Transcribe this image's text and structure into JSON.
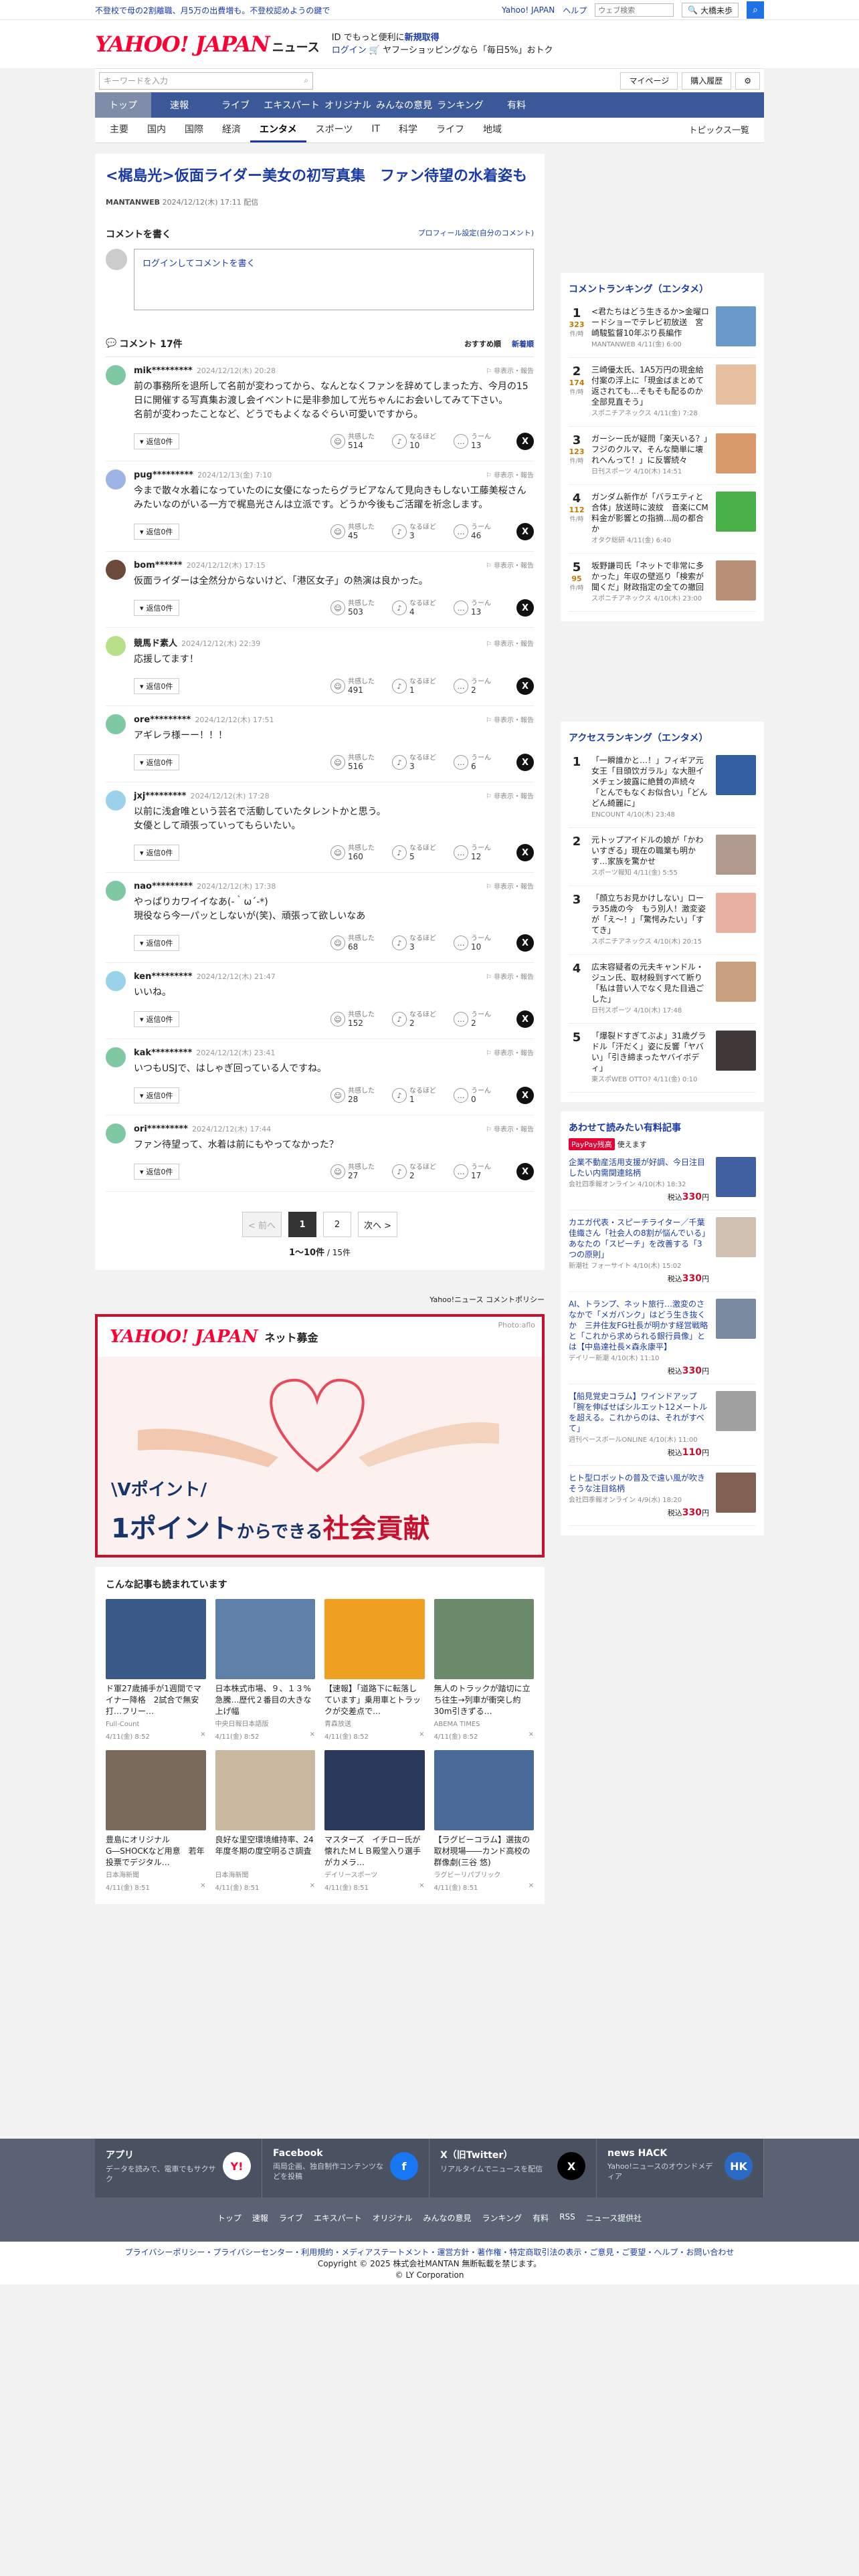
{
  "promo": {
    "text": "不登校で母の2割離職、月5万の出費増も。不登校認めようの鍵で",
    "links": [
      "Yahoo! JAPAN",
      "ヘルプ"
    ],
    "search_placeholder": "ウェブ検索",
    "bigsearch": "大橋未歩"
  },
  "header": {
    "logo": "YAHOO! JAPAN",
    "service": "ニュース",
    "msg1": "ID でもっと便利に",
    "msg1_link": "新規取得",
    "login": "ログイン",
    "msg2": "ヤフーショッピングなら「毎日5%」おトク"
  },
  "bar": {
    "search_placeholder": "キーワードを入力",
    "mypage": "マイページ",
    "purchase": "購入履歴"
  },
  "gnav": [
    "トップ",
    "速報",
    "ライブ",
    "エキスパート",
    "オリジナル",
    "みんなの意見",
    "ランキング",
    "有料"
  ],
  "cnav": [
    "主要",
    "国内",
    "国際",
    "経済",
    "エンタメ",
    "スポーツ",
    "IT",
    "科学",
    "ライフ",
    "地域"
  ],
  "cnav_right": "トピックス一覧",
  "article": {
    "title": "<梶島光>仮面ライダー美女の初写真集　ファン待望の水着姿も",
    "source": "MANTANWEB",
    "date": "2024/12/12(木) 17:11 配信"
  },
  "comment_write": {
    "label": "コメントを書く",
    "profile_link": "プロフィール設定(自分のコメント)",
    "login": "ログイン",
    "placeholder": "してコメントを書く"
  },
  "list": {
    "count": "コメント 17件",
    "sort_recommend": "おすすめ順",
    "sort_new": "新着順",
    "report": "非表示・報告",
    "reply": "返信0件",
    "rx": [
      "共感した",
      "なるほど",
      "うーん"
    ]
  },
  "comments": [
    {
      "user": "mik*********",
      "date": "2024/12/12(木) 20:28",
      "text": "前の事務所を退所して名前が変わってから、なんとなくファンを辞めてしまった方、今月の15日に開催する写真集お渡し会イベントに是非参加して光ちゃんにお会いしてみて下さい。\n名前が変わったことなど、どうでもよくなるぐらい可愛いですから。",
      "e": "514",
      "n": "10",
      "u": "13",
      "c": "#7ec8a3"
    },
    {
      "user": "pug*********",
      "date": "2024/12/13(金) 7:10",
      "text": "今まで散々水着になっていたのに女優になったらグラビアなんて見向きもしない工藤美桜さんみたいなのがいる一方で梶島光さんは立派です。どうか今後もご活躍を祈念します。",
      "e": "45",
      "n": "3",
      "u": "46",
      "c": "#9eb3e6"
    },
    {
      "user": "bom******",
      "date": "2024/12/12(木) 17:15",
      "text": "仮面ライダーは全然分からないけど、「港区女子」の熱演は良かった。",
      "e": "503",
      "n": "4",
      "u": "13",
      "c": "#6b4a3a"
    },
    {
      "user": "競馬ド素人",
      "date": "2024/12/12(木) 22:39",
      "text": "応援してます！",
      "e": "491",
      "n": "1",
      "u": "2",
      "c": "#b8e08a"
    },
    {
      "user": "ore*********",
      "date": "2024/12/12(木) 17:51",
      "text": "アギレラ様ーー！！！",
      "e": "516",
      "n": "3",
      "u": "6",
      "c": "#7ec8a3"
    },
    {
      "user": "jxj*********",
      "date": "2024/12/12(木) 17:28",
      "text": "以前に浅倉唯という芸名で活動していたタレントかと思う。\n女優として頑張っていってもらいたい。",
      "e": "160",
      "n": "5",
      "u": "12",
      "c": "#9ad2ec"
    },
    {
      "user": "nao*********",
      "date": "2024/12/12(木) 17:38",
      "text": "やっぱりカワイイなあ(-｀ω´-*)\n現役なら今一パッとしないが(笑)、頑張って欲しいなあ",
      "e": "68",
      "n": "3",
      "u": "10",
      "c": "#7ec8a3"
    },
    {
      "user": "ken*********",
      "date": "2024/12/12(木) 21:47",
      "text": "いいね。",
      "e": "152",
      "n": "2",
      "u": "2",
      "c": "#9ad2ec"
    },
    {
      "user": "kak*********",
      "date": "2024/12/12(木) 23:41",
      "text": "いつもUSJで、はしゃぎ回っている人ですね。",
      "e": "28",
      "n": "1",
      "u": "0",
      "c": "#7ec8a3"
    },
    {
      "user": "ori*********",
      "date": "2024/12/12(木) 17:44",
      "text": "ファン待望って、水着は前にもやってなかった？",
      "e": "27",
      "n": "2",
      "u": "17",
      "c": "#7ec8a3"
    }
  ],
  "pager": {
    "prev": "< 前へ",
    "next": "次へ >",
    "pages": [
      "1",
      "2"
    ],
    "count": "1〜10件",
    "total": "/ 15件"
  },
  "policy_link": "Yahoo!ニュース コメントポリシー",
  "ad": {
    "logo": "YAHOO! JAPAN",
    "name": "ネット募金",
    "credit": "Photo:aflo",
    "line1": "\\Vポイント/",
    "line2a": "1ポイント",
    "line2b": "からできる",
    "line2c": "社会貢献"
  },
  "recommended": {
    "heading": "こんな記事も読まれています",
    "items": [
      {
        "t": "ド軍27歳捕手が1週間でマイナー降格　2試合で無安打…フリー…",
        "s": "Full-Count",
        "d": "4/11(金) 8:52",
        "c": "#3a5a8a"
      },
      {
        "t": "日本株式市場、９、１３%急騰…歴代２番目の大きな上げ幅",
        "s": "中央日報日本語版",
        "d": "4/11(金) 8:52",
        "c": "#5d7fa8"
      },
      {
        "t": "【速報】「道路下に転落しています」乗用車とトラックが交差点で…",
        "s": "青森放送",
        "d": "4/11(金) 8:52",
        "c": "#f0a020"
      },
      {
        "t": "無人のトラックが踏切に立ち往生→列車が衝突し約30m引きずる…",
        "s": "ABEMA TIMES",
        "d": "4/11(金) 8:52",
        "c": "#6a8a6a"
      },
      {
        "t": "豊島にオリジナルG―SHOCKなど用意　若年投票でデジタル…",
        "s": "日本海新聞",
        "d": "4/11(金) 8:51",
        "c": "#7a6a5a"
      },
      {
        "t": "良好な里空環境維持率、24年度冬期の度空明るさ調査",
        "s": "日本海新聞",
        "d": "4/11(金) 8:51",
        "c": "#c8b8a0"
      },
      {
        "t": "マスターズ　イチロー氏が懐れたＭＬＢ殿堂入り選手がカメラ…",
        "s": "デイリースポーツ",
        "d": "4/11(金) 8:51",
        "c": "#2a3a5a"
      },
      {
        "t": "【ラグビーコラム】選抜の取材現場――カンド高校の群像劇(三谷 悠)",
        "s": "ラグビーリパブリック",
        "d": "4/11(金) 8:51",
        "c": "#4a6a9a"
      }
    ]
  },
  "side_comment_rank": {
    "heading": "コメントランキング（エンタメ）",
    "items": [
      {
        "r": "1",
        "cnt": "323",
        "t": "<君たちはどう生きるか>金曜ロードショーでテレビ初放送　宮崎駿監督10年ぶり長編作",
        "m": "MANTANWEB 4/11(金) 6:00",
        "c": "#6a9ac8"
      },
      {
        "r": "2",
        "cnt": "174",
        "t": "三崎優太氏、1A5万円の現金給付案の浮上に「現金ばまとめて返されても…そもそも配るのか全部見直そう」",
        "m": "スポニチアネックス 4/11(金) 7:28",
        "c": "#e8c0a0"
      },
      {
        "r": "3",
        "cnt": "123",
        "t": "ガーシー氏が疑問「楽天いる？」フジのクルマ、そんな簡単に壊れへんって！」に反響続々",
        "m": "日刊スポーツ 4/10(木) 14:51",
        "c": "#d89a6a"
      },
      {
        "r": "4",
        "cnt": "112",
        "t": "ガンダム新作が「バラエティと合体」放送時に波紋　音楽にCM料金が影響との指摘…局の都合か",
        "m": "オタク総研 4/11(金) 6:40",
        "c": "#4ab04a"
      },
      {
        "r": "5",
        "cnt": "95",
        "t": "坂野謙司氏「ネットで非常に多かった」年収の壁巡り「検索が聞くだ」財政指定の全ての撤回",
        "m": "スポニチアネックス 4/10(木) 23:00",
        "c": "#b89078"
      }
    ],
    "unit": "件/時"
  },
  "side_access_rank": {
    "heading": "アクセスランキング（エンタメ）",
    "items": [
      {
        "r": "1",
        "t": "「一瞬誰かと…！」フィギア元女王「目頭饮ガラル」な大胆イメチェン披露に絶賛の声続々「とんでもなくお似合い」「どんどん綺麗に」",
        "m": "ENCOUNT 4/10(木) 23:48",
        "c": "#3060a0"
      },
      {
        "r": "2",
        "t": "元トップアイドルの娘が「かわいすぎる」現在の職業も明かす…家族を驚かせ",
        "m": "スポーツ報知 4/11(金) 5:55",
        "c": "#b09a90"
      },
      {
        "r": "3",
        "t": "「顔立ちお見かけしない」ローラ35歳の今　もう別人！激変姿が「え〜！」「驚愕みたい」「すてき」",
        "m": "スポニチアネックス 4/10(木) 20:15",
        "c": "#e8b0a0"
      },
      {
        "r": "4",
        "t": "広末容疑者の元夫キャンドル・ジュン氏、取材殺到すべて断り「私は昔い人でなく見た目過ごした」",
        "m": "日刊スポーツ 4/10(木) 17:48",
        "c": "#c8a080"
      },
      {
        "r": "5",
        "t": "「爆裂ドすぎてぶよ」31歳グラドル「汗だく」姿に反響「ヤバい」「引き締まったヤバイボディ」",
        "m": "東スポWEB OTTO? 4/11(金) 0:10",
        "c": "#403838"
      }
    ]
  },
  "side_paid": {
    "heading": "あわせて読みたい有料記事",
    "badge": "PayPay残高",
    "badge2": "使えます",
    "price_label": "税込",
    "items": [
      {
        "t": "企業不動産活用支援が好調、今日注目したい内需関連銘柄",
        "m": "会社四季報オンライン 4/10(木) 18:32",
        "p": "330",
        "c": "#4060a0"
      },
      {
        "t": "カエガ代表・スピーチライター／千葉佳織さん「社会人の8割が悩んでいる」あなたの「スピーチ」を改善する「3つの原則」",
        "m": "新潮社 フォーサイト 4/10(木) 15:02",
        "p": "330",
        "c": "#d0c0b0"
      },
      {
        "t": "AI、トランプ、ネット旅行…激変のさなかで「メガバンク」はどう生き抜くか　三井住友FG社長が明かす経営戦略と「これから求められる銀行員像」とは【中島達社長×森永康平】",
        "m": "デイリー新潮 4/10(木) 11:10",
        "p": "330",
        "c": "#7a8aa0"
      },
      {
        "t": "【船見覚史コラム】ワインドアップ「腕を伸ばせばシルエット12メートルを超える。これからのは、それがすべて」",
        "m": "週刊ベースボールONLINE 4/10(木) 11:00",
        "p": "110",
        "c": "#a0a0a0"
      },
      {
        "t": "ヒト型ロボットの普及で遠い風が吹きそうな注目銘柄",
        "m": "会社四季報オンライン 4/9(水) 18:20",
        "p": "330",
        "c": "#806050"
      }
    ]
  },
  "footer": {
    "boxes": [
      {
        "t": "アプリ",
        "d": "データを読みで、電車でもサクサク",
        "ic": "Y!",
        "bg": "#fff",
        "fg": "#ff0033"
      },
      {
        "t": "Facebook",
        "d": "両局企画、独自制作コンテンツなどを投稿",
        "ic": "f",
        "bg": "#1877f2",
        "fg": "#fff"
      },
      {
        "t": "X（旧Twitter）",
        "d": "リアルタイムでニュースを配信",
        "ic": "X",
        "bg": "#000",
        "fg": "#fff"
      },
      {
        "t": "news HACK",
        "d": "Yahoo!ニュースのオウンドメディア",
        "ic": "HK",
        "bg": "#2b6bc8",
        "fg": "#fff"
      }
    ],
    "links": [
      "トップ",
      "速報",
      "ライブ",
      "エキスパート",
      "オリジナル",
      "みんなの意見",
      "ランキング",
      "有料",
      "RSS",
      "ニュース提供社"
    ],
    "legal_links": "プライバシーポリシー・プライバシーセンター・利用規約・メディアステートメント・運営方針・著作権・特定商取引法の表示・ご意見・ご要望・ヘルプ・お問い合わせ",
    "copy1": "Copyright © 2025 株式会社MANTAN 無断転載を禁じます。",
    "copy2": "© LY Corporation"
  }
}
